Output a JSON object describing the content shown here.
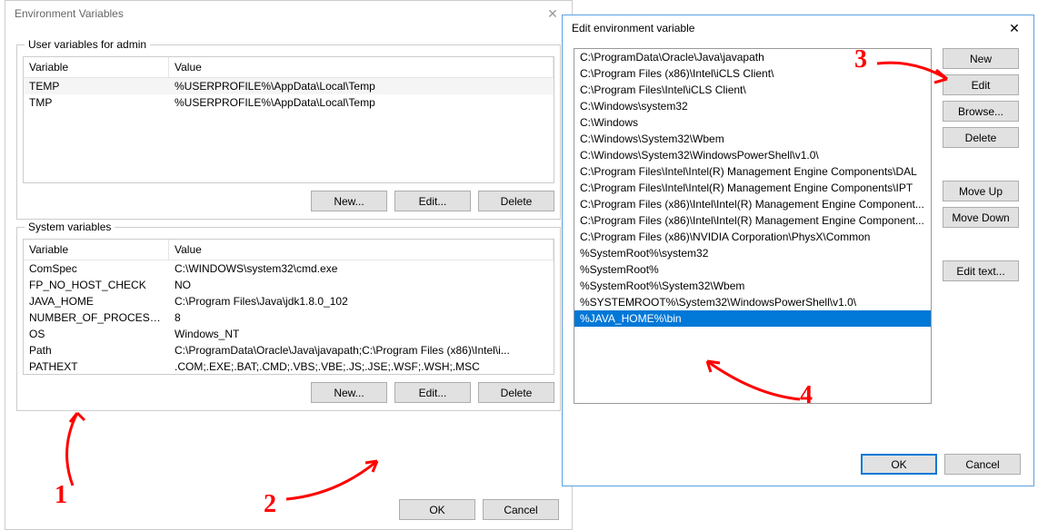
{
  "env_dialog": {
    "title": "Environment Variables",
    "user_group_label": "User variables for admin",
    "sys_group_label": "System variables",
    "col_variable": "Variable",
    "col_value": "Value",
    "user_vars": [
      {
        "name": "TEMP",
        "value": "%USERPROFILE%\\AppData\\Local\\Temp"
      },
      {
        "name": "TMP",
        "value": "%USERPROFILE%\\AppData\\Local\\Temp"
      }
    ],
    "sys_vars": [
      {
        "name": "ComSpec",
        "value": "C:\\WINDOWS\\system32\\cmd.exe"
      },
      {
        "name": "FP_NO_HOST_CHECK",
        "value": "NO"
      },
      {
        "name": "JAVA_HOME",
        "value": "C:\\Program Files\\Java\\jdk1.8.0_102"
      },
      {
        "name": "NUMBER_OF_PROCESSORS",
        "value": "8"
      },
      {
        "name": "OS",
        "value": "Windows_NT"
      },
      {
        "name": "Path",
        "value": "C:\\ProgramData\\Oracle\\Java\\javapath;C:\\Program Files (x86)\\Intel\\i..."
      },
      {
        "name": "PATHEXT",
        "value": ".COM;.EXE;.BAT;.CMD;.VBS;.VBE;.JS;.JSE;.WSF;.WSH;.MSC"
      }
    ],
    "btn_new": "New...",
    "btn_edit": "Edit...",
    "btn_delete": "Delete",
    "btn_ok": "OK",
    "btn_cancel": "Cancel"
  },
  "edit_dialog": {
    "title": "Edit environment variable",
    "entries": [
      "C:\\ProgramData\\Oracle\\Java\\javapath",
      "C:\\Program Files (x86)\\Intel\\iCLS Client\\",
      "C:\\Program Files\\Intel\\iCLS Client\\",
      "C:\\Windows\\system32",
      "C:\\Windows",
      "C:\\Windows\\System32\\Wbem",
      "C:\\Windows\\System32\\WindowsPowerShell\\v1.0\\",
      "C:\\Program Files\\Intel\\Intel(R) Management Engine Components\\DAL",
      "C:\\Program Files\\Intel\\Intel(R) Management Engine Components\\IPT",
      "C:\\Program Files (x86)\\Intel\\Intel(R) Management Engine Component...",
      "C:\\Program Files (x86)\\Intel\\Intel(R) Management Engine Component...",
      "C:\\Program Files (x86)\\NVIDIA Corporation\\PhysX\\Common",
      "%SystemRoot%\\system32",
      "%SystemRoot%",
      "%SystemRoot%\\System32\\Wbem",
      "%SYSTEMROOT%\\System32\\WindowsPowerShell\\v1.0\\",
      "%JAVA_HOME%\\bin"
    ],
    "selected_index": 16,
    "btn_new": "New",
    "btn_edit": "Edit",
    "btn_browse": "Browse...",
    "btn_delete": "Delete",
    "btn_moveup": "Move Up",
    "btn_movedown": "Move Down",
    "btn_edittext": "Edit text...",
    "btn_ok": "OK",
    "btn_cancel": "Cancel"
  },
  "annotations": {
    "n1": "1",
    "n2": "2",
    "n3": "3",
    "n4": "4"
  }
}
